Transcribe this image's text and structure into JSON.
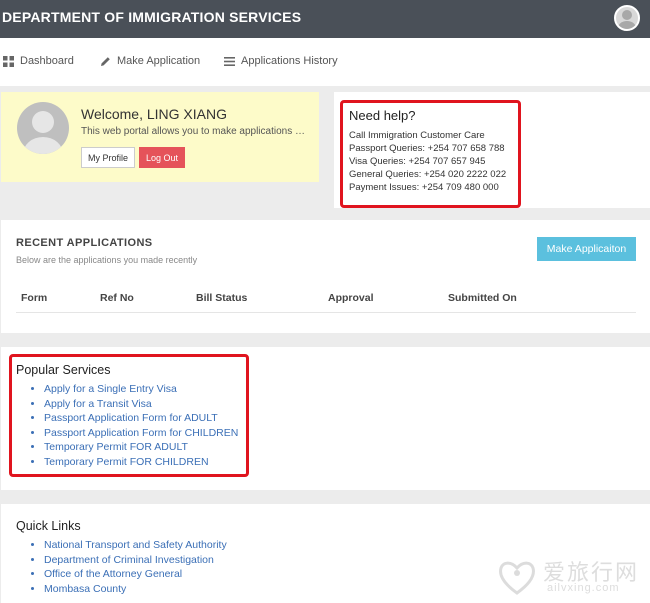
{
  "header": {
    "title": "DEPARTMENT OF IMMIGRATION SERVICES"
  },
  "nav": {
    "items": [
      {
        "label": "Dashboard",
        "icon": "grid-icon"
      },
      {
        "label": "Make Application",
        "icon": "pencil-icon"
      },
      {
        "label": "Applications History",
        "icon": "list-icon"
      }
    ]
  },
  "welcome": {
    "title": "Welcome, LING XIANG",
    "description": "This web portal allows you to make applications as...",
    "profile_label": "My Profile",
    "logout_label": "Log Out"
  },
  "help": {
    "title": "Need help?",
    "lines": [
      "Call Immigration Customer Care",
      "Passport Queries: +254 707 658 788",
      "Visa Queries: +254 707 657 945",
      "General Queries: +254 020 2222 022",
      "Payment Issues: +254 709 480 000"
    ]
  },
  "recent": {
    "title": "RECENT APPLICATIONS",
    "subtitle": "Below are the applications you made recently",
    "make_label": "Make Applicaiton",
    "columns": [
      "Form",
      "Ref No",
      "Bill Status",
      "Approval",
      "Submitted On"
    ]
  },
  "popular": {
    "title": "Popular Services",
    "links": [
      "Apply for a Single Entry Visa",
      "Apply for a Transit Visa",
      "Passport Application Form for ADULT",
      "Passport Application Form for CHILDREN",
      "Temporary Permit FOR ADULT",
      "Temporary Permit FOR CHILDREN"
    ]
  },
  "quick": {
    "title": "Quick Links",
    "links": [
      "National Transport and Safety Authority",
      "Department of Criminal Investigation",
      "Office of the Attorney General",
      "Mombasa County"
    ]
  },
  "watermark": {
    "text": "爱旅行网",
    "sub": "ailvxing.com"
  },
  "colors": {
    "topbar": "#4a5058",
    "highlight": "#e0141e",
    "link": "#3b6fb6",
    "primary_button": "#5bc0de",
    "danger_button": "#e5535a",
    "welcome_bg": "#fdfbc9"
  }
}
